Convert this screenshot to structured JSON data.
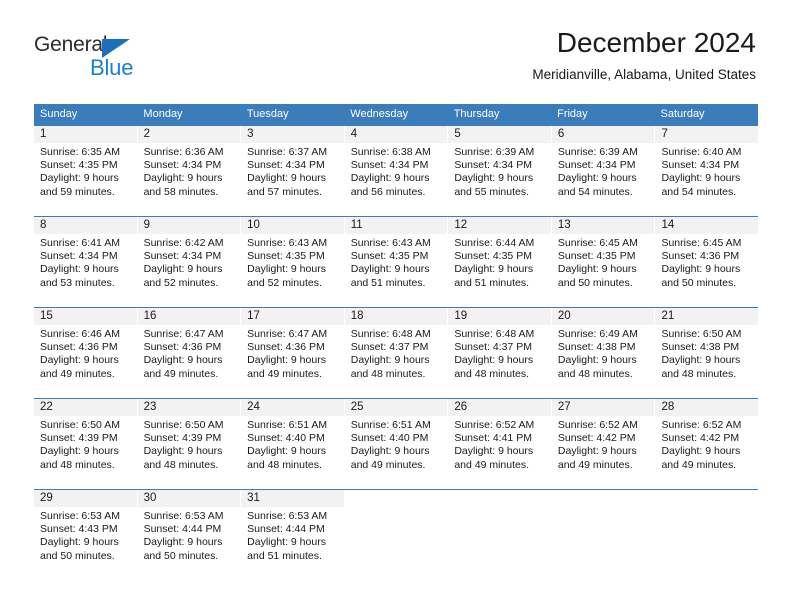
{
  "brand": {
    "name_part1": "General",
    "name_part2": "Blue",
    "accent_color": "#1b7fd4",
    "triangle_color": "#1c6fba"
  },
  "header": {
    "title": "December 2024",
    "subtitle": "Meridianville, Alabama, United States"
  },
  "theme": {
    "header_row_bg": "#3b7cbb",
    "day_band_bg": "#f2f2f2",
    "text_color": "#1a1a1a"
  },
  "calendar": {
    "weekdays": [
      "Sunday",
      "Monday",
      "Tuesday",
      "Wednesday",
      "Thursday",
      "Friday",
      "Saturday"
    ],
    "weeks": [
      [
        {
          "day": "1",
          "sunrise": "Sunrise: 6:35 AM",
          "sunset": "Sunset: 4:35 PM",
          "daylight1": "Daylight: 9 hours",
          "daylight2": "and 59 minutes."
        },
        {
          "day": "2",
          "sunrise": "Sunrise: 6:36 AM",
          "sunset": "Sunset: 4:34 PM",
          "daylight1": "Daylight: 9 hours",
          "daylight2": "and 58 minutes."
        },
        {
          "day": "3",
          "sunrise": "Sunrise: 6:37 AM",
          "sunset": "Sunset: 4:34 PM",
          "daylight1": "Daylight: 9 hours",
          "daylight2": "and 57 minutes."
        },
        {
          "day": "4",
          "sunrise": "Sunrise: 6:38 AM",
          "sunset": "Sunset: 4:34 PM",
          "daylight1": "Daylight: 9 hours",
          "daylight2": "and 56 minutes."
        },
        {
          "day": "5",
          "sunrise": "Sunrise: 6:39 AM",
          "sunset": "Sunset: 4:34 PM",
          "daylight1": "Daylight: 9 hours",
          "daylight2": "and 55 minutes."
        },
        {
          "day": "6",
          "sunrise": "Sunrise: 6:39 AM",
          "sunset": "Sunset: 4:34 PM",
          "daylight1": "Daylight: 9 hours",
          "daylight2": "and 54 minutes."
        },
        {
          "day": "7",
          "sunrise": "Sunrise: 6:40 AM",
          "sunset": "Sunset: 4:34 PM",
          "daylight1": "Daylight: 9 hours",
          "daylight2": "and 54 minutes."
        }
      ],
      [
        {
          "day": "8",
          "sunrise": "Sunrise: 6:41 AM",
          "sunset": "Sunset: 4:34 PM",
          "daylight1": "Daylight: 9 hours",
          "daylight2": "and 53 minutes."
        },
        {
          "day": "9",
          "sunrise": "Sunrise: 6:42 AM",
          "sunset": "Sunset: 4:34 PM",
          "daylight1": "Daylight: 9 hours",
          "daylight2": "and 52 minutes."
        },
        {
          "day": "10",
          "sunrise": "Sunrise: 6:43 AM",
          "sunset": "Sunset: 4:35 PM",
          "daylight1": "Daylight: 9 hours",
          "daylight2": "and 52 minutes."
        },
        {
          "day": "11",
          "sunrise": "Sunrise: 6:43 AM",
          "sunset": "Sunset: 4:35 PM",
          "daylight1": "Daylight: 9 hours",
          "daylight2": "and 51 minutes."
        },
        {
          "day": "12",
          "sunrise": "Sunrise: 6:44 AM",
          "sunset": "Sunset: 4:35 PM",
          "daylight1": "Daylight: 9 hours",
          "daylight2": "and 51 minutes."
        },
        {
          "day": "13",
          "sunrise": "Sunrise: 6:45 AM",
          "sunset": "Sunset: 4:35 PM",
          "daylight1": "Daylight: 9 hours",
          "daylight2": "and 50 minutes."
        },
        {
          "day": "14",
          "sunrise": "Sunrise: 6:45 AM",
          "sunset": "Sunset: 4:36 PM",
          "daylight1": "Daylight: 9 hours",
          "daylight2": "and 50 minutes."
        }
      ],
      [
        {
          "day": "15",
          "sunrise": "Sunrise: 6:46 AM",
          "sunset": "Sunset: 4:36 PM",
          "daylight1": "Daylight: 9 hours",
          "daylight2": "and 49 minutes."
        },
        {
          "day": "16",
          "sunrise": "Sunrise: 6:47 AM",
          "sunset": "Sunset: 4:36 PM",
          "daylight1": "Daylight: 9 hours",
          "daylight2": "and 49 minutes."
        },
        {
          "day": "17",
          "sunrise": "Sunrise: 6:47 AM",
          "sunset": "Sunset: 4:36 PM",
          "daylight1": "Daylight: 9 hours",
          "daylight2": "and 49 minutes."
        },
        {
          "day": "18",
          "sunrise": "Sunrise: 6:48 AM",
          "sunset": "Sunset: 4:37 PM",
          "daylight1": "Daylight: 9 hours",
          "daylight2": "and 48 minutes."
        },
        {
          "day": "19",
          "sunrise": "Sunrise: 6:48 AM",
          "sunset": "Sunset: 4:37 PM",
          "daylight1": "Daylight: 9 hours",
          "daylight2": "and 48 minutes."
        },
        {
          "day": "20",
          "sunrise": "Sunrise: 6:49 AM",
          "sunset": "Sunset: 4:38 PM",
          "daylight1": "Daylight: 9 hours",
          "daylight2": "and 48 minutes."
        },
        {
          "day": "21",
          "sunrise": "Sunrise: 6:50 AM",
          "sunset": "Sunset: 4:38 PM",
          "daylight1": "Daylight: 9 hours",
          "daylight2": "and 48 minutes."
        }
      ],
      [
        {
          "day": "22",
          "sunrise": "Sunrise: 6:50 AM",
          "sunset": "Sunset: 4:39 PM",
          "daylight1": "Daylight: 9 hours",
          "daylight2": "and 48 minutes."
        },
        {
          "day": "23",
          "sunrise": "Sunrise: 6:50 AM",
          "sunset": "Sunset: 4:39 PM",
          "daylight1": "Daylight: 9 hours",
          "daylight2": "and 48 minutes."
        },
        {
          "day": "24",
          "sunrise": "Sunrise: 6:51 AM",
          "sunset": "Sunset: 4:40 PM",
          "daylight1": "Daylight: 9 hours",
          "daylight2": "and 48 minutes."
        },
        {
          "day": "25",
          "sunrise": "Sunrise: 6:51 AM",
          "sunset": "Sunset: 4:40 PM",
          "daylight1": "Daylight: 9 hours",
          "daylight2": "and 49 minutes."
        },
        {
          "day": "26",
          "sunrise": "Sunrise: 6:52 AM",
          "sunset": "Sunset: 4:41 PM",
          "daylight1": "Daylight: 9 hours",
          "daylight2": "and 49 minutes."
        },
        {
          "day": "27",
          "sunrise": "Sunrise: 6:52 AM",
          "sunset": "Sunset: 4:42 PM",
          "daylight1": "Daylight: 9 hours",
          "daylight2": "and 49 minutes."
        },
        {
          "day": "28",
          "sunrise": "Sunrise: 6:52 AM",
          "sunset": "Sunset: 4:42 PM",
          "daylight1": "Daylight: 9 hours",
          "daylight2": "and 49 minutes."
        }
      ],
      [
        {
          "day": "29",
          "sunrise": "Sunrise: 6:53 AM",
          "sunset": "Sunset: 4:43 PM",
          "daylight1": "Daylight: 9 hours",
          "daylight2": "and 50 minutes."
        },
        {
          "day": "30",
          "sunrise": "Sunrise: 6:53 AM",
          "sunset": "Sunset: 4:44 PM",
          "daylight1": "Daylight: 9 hours",
          "daylight2": "and 50 minutes."
        },
        {
          "day": "31",
          "sunrise": "Sunrise: 6:53 AM",
          "sunset": "Sunset: 4:44 PM",
          "daylight1": "Daylight: 9 hours",
          "daylight2": "and 51 minutes."
        },
        {
          "day": "",
          "sunrise": "",
          "sunset": "",
          "daylight1": "",
          "daylight2": ""
        },
        {
          "day": "",
          "sunrise": "",
          "sunset": "",
          "daylight1": "",
          "daylight2": ""
        },
        {
          "day": "",
          "sunrise": "",
          "sunset": "",
          "daylight1": "",
          "daylight2": ""
        },
        {
          "day": "",
          "sunrise": "",
          "sunset": "",
          "daylight1": "",
          "daylight2": ""
        }
      ]
    ]
  }
}
